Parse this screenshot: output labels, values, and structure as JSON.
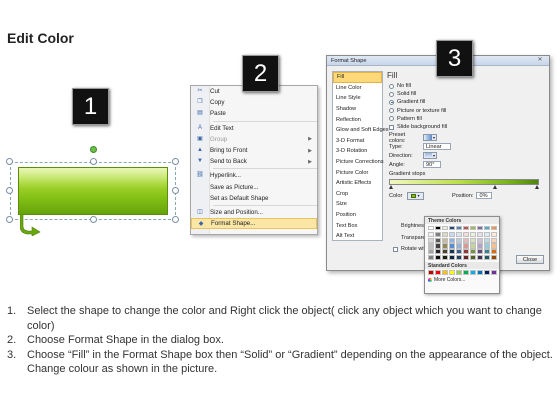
{
  "title": "Edit Color",
  "steps": [
    "1",
    "2",
    "3"
  ],
  "context_menu": {
    "items": [
      {
        "label": "Cut",
        "icon": "scissors-icon",
        "glyph": "✂",
        "disabled": false
      },
      {
        "label": "Copy",
        "icon": "copy-icon",
        "glyph": "❐",
        "disabled": false
      },
      {
        "label": "Paste",
        "icon": "paste-icon",
        "glyph": "▤",
        "disabled": false
      },
      {
        "label": "Edit Text",
        "icon": "edit-text-icon",
        "glyph": "A",
        "disabled": false
      },
      {
        "label": "Group",
        "icon": "group-icon",
        "glyph": "▣",
        "disabled": true,
        "submenu": true
      },
      {
        "label": "Bring to Front",
        "icon": "bring-front-icon",
        "glyph": "▲",
        "disabled": false,
        "submenu": true
      },
      {
        "label": "Send to Back",
        "icon": "send-back-icon",
        "glyph": "▼",
        "disabled": false,
        "submenu": true
      },
      {
        "label": "Hyperlink...",
        "icon": "hyperlink-icon",
        "glyph": "⛓",
        "disabled": false
      },
      {
        "label": "Save as Picture...",
        "icon": "",
        "glyph": "",
        "disabled": false
      },
      {
        "label": "Set as Default Shape",
        "icon": "",
        "glyph": "",
        "disabled": false
      },
      {
        "label": "Size and Position...",
        "icon": "size-position-icon",
        "glyph": "◫",
        "disabled": false
      },
      {
        "label": "Format Shape...",
        "icon": "format-shape-icon",
        "glyph": "◆",
        "disabled": false,
        "highlight": true
      }
    ]
  },
  "dialog": {
    "title": "Format Shape",
    "nav": [
      "Fill",
      "Line Color",
      "Line Style",
      "Shadow",
      "Reflection",
      "Glow and Soft Edges",
      "3-D Format",
      "3-D Rotation",
      "Picture Corrections",
      "Picture Color",
      "Artistic Effects",
      "Crop",
      "Size",
      "Position",
      "Text Box",
      "Alt Text"
    ],
    "active_nav": "Fill",
    "heading": "Fill",
    "fill_options": [
      {
        "label": "No fill",
        "selected": false
      },
      {
        "label": "Solid fill",
        "selected": false
      },
      {
        "label": "Gradient fill",
        "selected": true
      },
      {
        "label": "Picture or texture fill",
        "selected": false
      },
      {
        "label": "Pattern fill",
        "selected": false
      }
    ],
    "slide_bg": "Slide background fill",
    "preset_label": "Preset colors:",
    "type_label": "Type:",
    "type_value": "Linear",
    "direction_label": "Direction:",
    "angle_label": "Angle:",
    "angle_value": "90°",
    "stops_label": "Gradient stops",
    "color_label": "Color",
    "position_label": "Position:",
    "position_value": "0%",
    "brightness_label": "Brightness:",
    "transparency_label": "Transparency:",
    "rotate_label": "Rotate with shape",
    "close_label": "Close"
  },
  "palette": {
    "theme_heading": "Theme Colors",
    "standard_heading": "Standard Colors",
    "more_label": "More Colors...",
    "theme_top": [
      "#ffffff",
      "#000000",
      "#eeece1",
      "#1f497d",
      "#4f81bd",
      "#c0504d",
      "#9bbb59",
      "#8064a2",
      "#4bacc6",
      "#f79646"
    ],
    "theme_shades": [
      [
        "#f2f2f2",
        "#7f7f7f",
        "#ddd9c3",
        "#c6d9f0",
        "#dbe5f1",
        "#f2dcdb",
        "#ebf1dd",
        "#e5e0ec",
        "#dbeef3",
        "#fdeada"
      ],
      [
        "#d8d8d8",
        "#595959",
        "#c4bd97",
        "#8db3e2",
        "#b8cce4",
        "#e5b9b7",
        "#d7e3bc",
        "#ccc1d9",
        "#b7dde8",
        "#fbd5b5"
      ],
      [
        "#bfbfbf",
        "#3f3f3f",
        "#938953",
        "#548dd4",
        "#95b3d7",
        "#d99694",
        "#c3d69b",
        "#b2a2c7",
        "#92cddc",
        "#fac08f"
      ],
      [
        "#a5a5a5",
        "#262626",
        "#494429",
        "#17365d",
        "#366092",
        "#953734",
        "#76923c",
        "#5f497a",
        "#31859b",
        "#e36c09"
      ],
      [
        "#7f7f7f",
        "#0c0c0c",
        "#1d1b10",
        "#0f243e",
        "#244061",
        "#632423",
        "#4f6128",
        "#3f3151",
        "#205867",
        "#974806"
      ]
    ],
    "standard": [
      "#c00000",
      "#ff0000",
      "#ffc000",
      "#ffff00",
      "#92d050",
      "#00b050",
      "#00b0f0",
      "#0070c0",
      "#002060",
      "#7030a0"
    ]
  },
  "instructions": [
    {
      "num": "1.",
      "text": "Select the shape to change the color and Right click the object( click any object which you want to change color)"
    },
    {
      "num": "2.",
      "text": "Choose Format Shape in the dialog box."
    },
    {
      "num": "3.",
      "text": "Choose “Fill” in the Format Shape box then “Solid” or “Gradient” depending on the appearance of the object. Change colour as shown in the picture."
    }
  ]
}
